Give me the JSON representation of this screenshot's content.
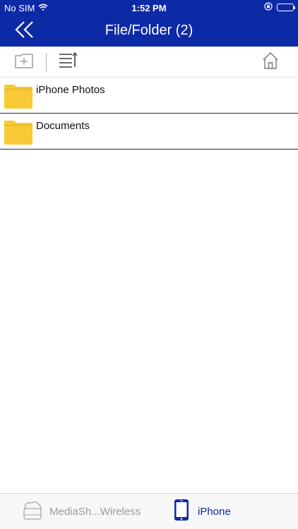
{
  "status_bar": {
    "carrier": "No SIM",
    "time": "1:52 PM",
    "icons": [
      "wifi-icon",
      "orientation-lock-icon",
      "battery-icon"
    ]
  },
  "nav": {
    "title": "File/Folder (2)",
    "back_icon": "double-chevron-left-icon"
  },
  "toolbar": {
    "icons": [
      "new-folder-icon",
      "sort-icon",
      "home-icon"
    ]
  },
  "files": {
    "items": [
      {
        "label": "iPhone Photos",
        "icon": "folder-icon"
      },
      {
        "label": "Documents",
        "icon": "folder-icon"
      }
    ]
  },
  "tabs": {
    "items": [
      {
        "label": "MediaSh...Wireless",
        "icon": "wireless-drive-icon",
        "selected": false
      },
      {
        "label": "iPhone",
        "icon": "iphone-icon",
        "selected": true
      }
    ]
  },
  "colors": {
    "header_bg": "#0d2aa6",
    "folder": "#f7c934",
    "tab_selected": "#0d2aa6",
    "tab_unselected": "#9a9a9a"
  }
}
